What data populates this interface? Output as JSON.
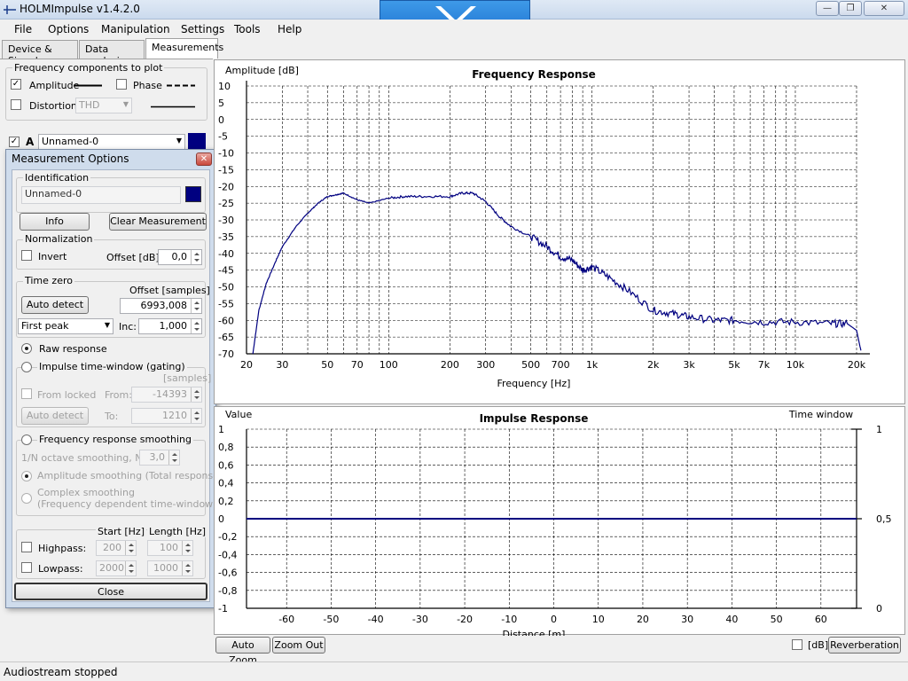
{
  "window": {
    "title": "HOLMImpulse  v1.4.2.0",
    "min_glyph": "—",
    "max_glyph": "❐",
    "close_glyph": "✕"
  },
  "menu": [
    "File",
    "Options",
    "Manipulation",
    "Settings",
    "Tools",
    "Help"
  ],
  "tabs": [
    "Device & Signal",
    "Data analysis",
    "Measurements"
  ],
  "active_tab": "Measurements",
  "freq_components": {
    "title": "Frequency components to plot",
    "amplitude": {
      "label": "Amplitude",
      "checked": true
    },
    "phase": {
      "label": "Phase",
      "checked": false
    },
    "distortion": {
      "label": "Distortion",
      "checked": false,
      "select": "THD"
    }
  },
  "measurement_row": {
    "checked": true,
    "letter": "A",
    "name": "Unnamed-0",
    "color": "#000080"
  },
  "dialog": {
    "title": "Measurement Options",
    "close_glyph": "✕",
    "identification": {
      "legend": "Identification",
      "name": "Unnamed-0",
      "color": "#000080"
    },
    "info_button": "Info",
    "clear_button": "Clear Measurement",
    "normalization": {
      "legend": "Normalization",
      "invert_label": "Invert",
      "offset_label": "Offset [dB]:",
      "offset_value": "0,0"
    },
    "time_zero": {
      "legend": "Time zero",
      "offset_label": "Offset [samples]",
      "auto_detect": "Auto detect",
      "offset_value": "6993,008",
      "peak_select": "First peak",
      "inc_label": "Inc:",
      "inc_value": "1,000"
    },
    "raw_response": "Raw response",
    "impulse_window": {
      "label": "Impulse time-window (gating)",
      "samples_label": "[samples]",
      "from_locked": "From locked",
      "from_label": "From:",
      "from_value": "-14393",
      "auto_detect": "Auto detect",
      "to_label": "To:",
      "to_value": "1210"
    },
    "smoothing": {
      "label": "Frequency response smoothing",
      "n_label": "1/N octave smoothing, N=",
      "n_value": "3,0",
      "amplitude": "Amplitude smoothing (Total response)",
      "complex_line1": "Complex smoothing",
      "complex_line2": "(Frequency dependent time-window)"
    },
    "filters": {
      "start_header": "Start [Hz]",
      "length_header": "Length [Hz]",
      "highpass": {
        "label": "Highpass:",
        "start": "200",
        "length": "100"
      },
      "lowpass": {
        "label": "Lowpass:",
        "start": "2000",
        "length": "1000"
      }
    },
    "close_button": "Close"
  },
  "freq_chart": {
    "ylabel": "Amplitude [dB]",
    "xlabel": "Frequency [Hz]",
    "color": "#000080"
  },
  "imp_chart": {
    "ylabel": "Value",
    "right_label": "Time window",
    "xlabel": "Distance [m]",
    "color": "#000080"
  },
  "chart_data": [
    {
      "type": "line",
      "title": "Frequency Response",
      "xlabel": "Frequency [Hz]",
      "ylabel": "Amplitude [dB]",
      "x_scale": "log",
      "xlim": [
        20,
        20000
      ],
      "ylim": [
        -70,
        10
      ],
      "grid": true,
      "y_ticks": [
        "10",
        "5",
        "0",
        "-5",
        "-10",
        "-15",
        "-20",
        "-25",
        "-30",
        "-35",
        "-40",
        "-45",
        "-50",
        "-55",
        "-60",
        "-65",
        "-70"
      ],
      "x_ticks": [
        {
          "v": 20,
          "t": "20"
        },
        {
          "v": 30,
          "t": "30"
        },
        {
          "v": 50,
          "t": "50"
        },
        {
          "v": 70,
          "t": "70"
        },
        {
          "v": 100,
          "t": "100"
        },
        {
          "v": 200,
          "t": "200"
        },
        {
          "v": 300,
          "t": "300"
        },
        {
          "v": 500,
          "t": "500"
        },
        {
          "v": 700,
          "t": "700"
        },
        {
          "v": 1000,
          "t": "1k"
        },
        {
          "v": 2000,
          "t": "2k"
        },
        {
          "v": 3000,
          "t": "3k"
        },
        {
          "v": 5000,
          "t": "5k"
        },
        {
          "v": 7000,
          "t": "7k"
        },
        {
          "v": 10000,
          "t": "10k"
        },
        {
          "v": 20000,
          "t": "20k"
        }
      ],
      "series": [
        {
          "x": [
            21.5,
            23,
            25,
            28,
            30,
            35,
            40,
            45,
            50,
            55,
            60,
            70,
            80,
            100,
            120,
            150,
            200,
            230,
            260,
            300,
            350,
            400,
            500,
            600,
            700,
            800,
            900,
            1000,
            1200,
            1500,
            2000,
            2500,
            3000,
            4000,
            5000,
            7000,
            10000,
            15000,
            18000,
            20000,
            21000
          ],
          "y": [
            -70,
            -57,
            -49,
            -42,
            -38,
            -32,
            -28,
            -25,
            -23,
            -22.5,
            -22,
            -24,
            -25,
            -23.5,
            -23,
            -23,
            -23,
            -22,
            -22,
            -24.5,
            -29,
            -32,
            -35,
            -38,
            -41,
            -42,
            -45,
            -44,
            -47,
            -51,
            -57,
            -58,
            -59,
            -60,
            -60,
            -60.5,
            -60.5,
            -61,
            -61,
            -63,
            -69
          ]
        }
      ]
    },
    {
      "type": "line",
      "title": "Impulse Response",
      "xlabel": "Distance [m]",
      "ylabel": "Value",
      "xlim": [
        -69,
        68
      ],
      "ylim": [
        -1,
        1
      ],
      "grid": true,
      "y_ticks": [
        "1",
        "0,8",
        "0,6",
        "0,4",
        "0,2",
        "0",
        "-0,2",
        "-0,4",
        "-0,6",
        "-0,8",
        "-1"
      ],
      "x_ticks": [
        "-60",
        "-50",
        "-40",
        "-30",
        "-20",
        "-10",
        "0",
        "10",
        "20",
        "30",
        "40",
        "50",
        "60"
      ],
      "right_axis": {
        "label": "Time window",
        "ticks": [
          "1",
          "0,5",
          "0"
        ]
      },
      "series": [
        {
          "x": [
            -69,
            68
          ],
          "y": [
            0,
            0
          ]
        }
      ]
    }
  ],
  "freq_buttons": {
    "scroll_up": "▲",
    "scroll_down": "▼"
  },
  "bottom_buttons": {
    "auto_zoom": "Auto Zoom",
    "zoom_out": "Zoom Out",
    "db_label": "[dB]",
    "reverberation": "Reverberation"
  },
  "status": "Audiostream stopped"
}
